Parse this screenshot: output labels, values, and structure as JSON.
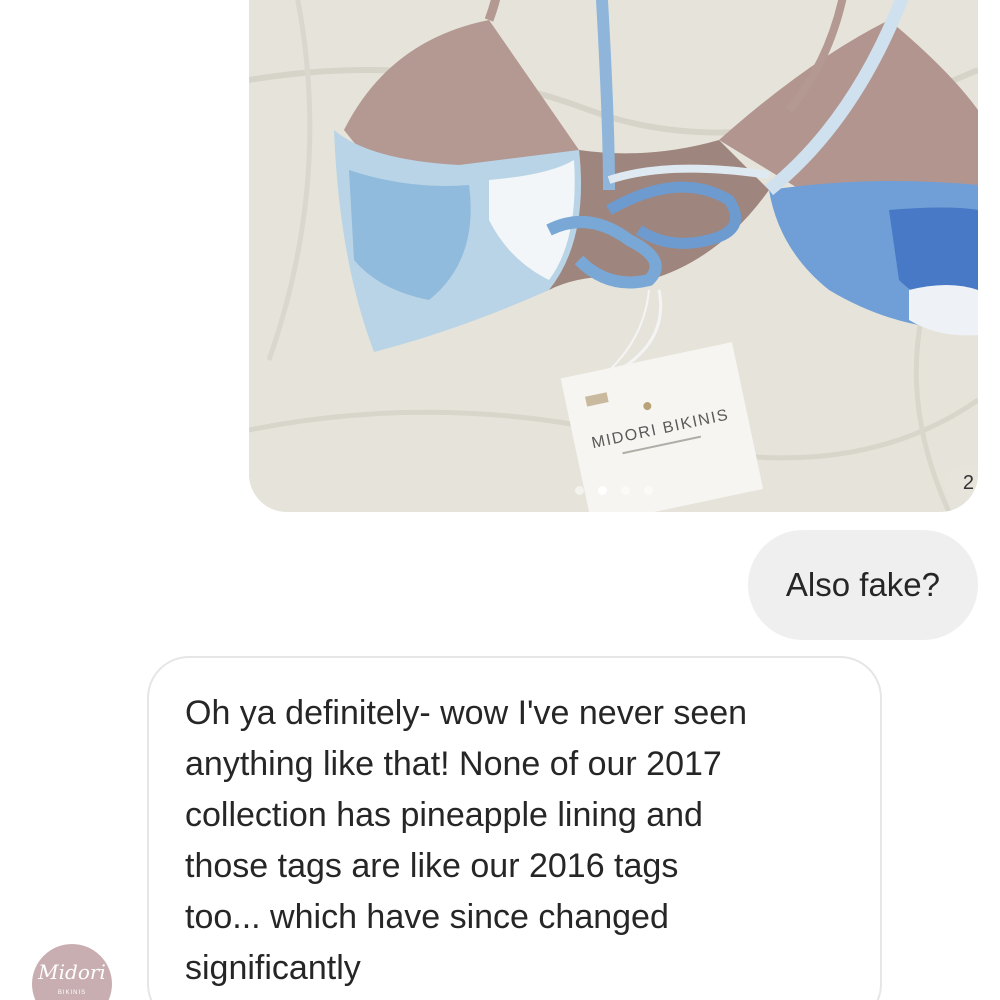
{
  "thread": {
    "photo_message": {
      "tag_brand": "MIDORI BIKINIS",
      "page_counter": "2",
      "dots_total": 4,
      "dots_active_index": 1
    },
    "sent_message": {
      "text": "Also fake?"
    },
    "received_message": {
      "lines": [
        "Oh ya definitely- wow I've never seen",
        "anything like that! None of our 2017",
        "collection has pineapple lining and",
        "those tags are like our 2016 tags",
        "too... which have since changed",
        "significantly"
      ]
    },
    "sender_avatar": {
      "script_text": "Midori",
      "sub_text": "BIKINIS"
    }
  },
  "colors": {
    "sent_bubble_bg": "#efefef",
    "received_border": "#e6e6e6",
    "text": "#262626",
    "avatar_bg": "#c9aeb1"
  }
}
